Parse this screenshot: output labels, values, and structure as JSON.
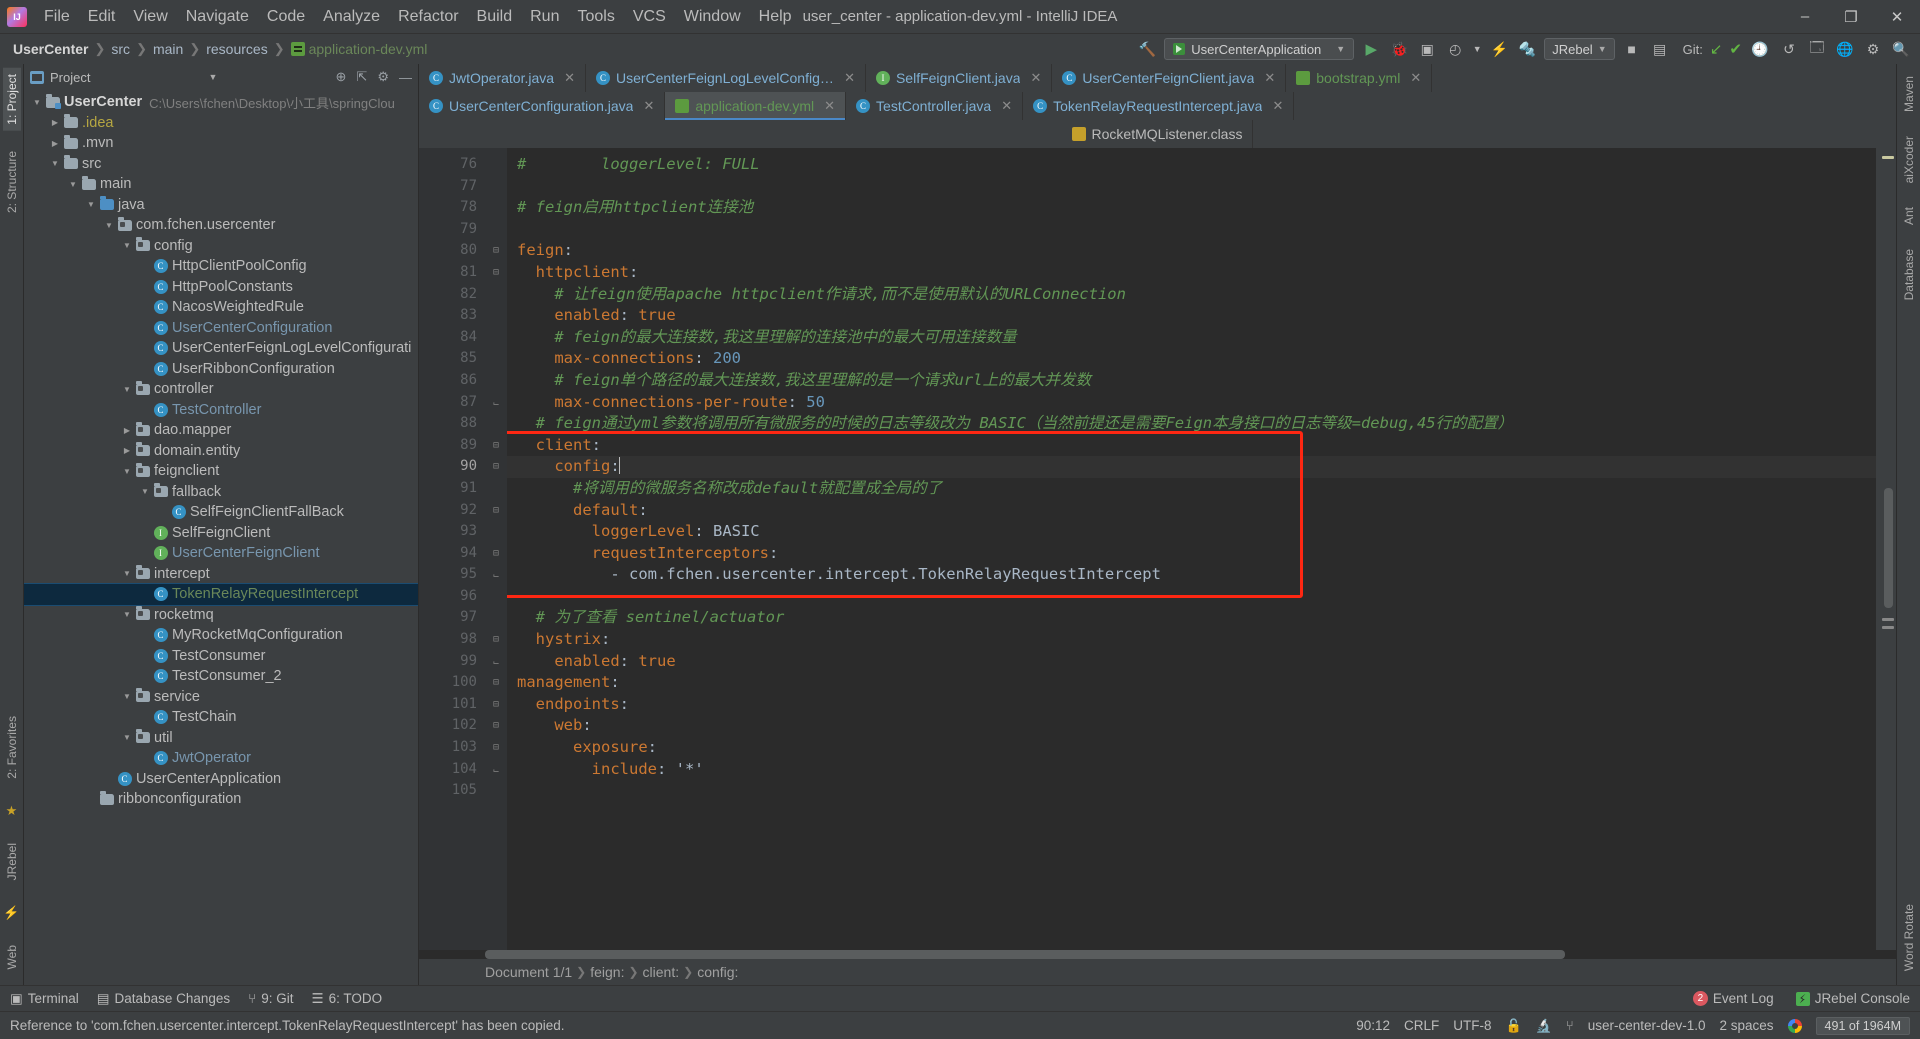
{
  "window": {
    "title": "user_center - application-dev.yml - IntelliJ IDEA",
    "minimize": "–",
    "maximize": "❐",
    "close": "✕"
  },
  "menu": [
    "File",
    "Edit",
    "View",
    "Navigate",
    "Code",
    "Analyze",
    "Refactor",
    "Build",
    "Run",
    "Tools",
    "VCS",
    "Window",
    "Help"
  ],
  "navbar": {
    "crumbs": [
      "UserCenter",
      "src",
      "main",
      "resources",
      "application-dev.yml"
    ],
    "run_config": "UserCenterApplication",
    "jrebel_label": "JRebel",
    "git_label": "Git:",
    "hammer_icon": "build-icon",
    "run_icon": "run-icon",
    "debug_icon": "debug-icon",
    "coverage_icon": "coverage-icon",
    "profiler_icon": "profiler-icon",
    "stop_icon": "stop-icon",
    "update_icon": "update-project-icon",
    "commit_icon": "commit-icon",
    "rollback_icon": "rollback-icon",
    "search_icon": "search-everywhere-icon",
    "settings_icon": "settings-icon"
  },
  "left_rail": {
    "tabs": [
      "1: Project",
      "2: Structure",
      "2: Favorites",
      "JRebel",
      "Web"
    ],
    "star_icon": "favorites-star-icon"
  },
  "right_rail": {
    "tabs": [
      "Maven",
      "aiXcoder",
      "Ant",
      "Database",
      "Word Rotate"
    ]
  },
  "project_panel": {
    "title": "Project",
    "expand_icon": "locate-icon",
    "collapse_icon": "collapse-all-icon",
    "settings_icon": "gear-icon",
    "hide_icon": "hide-icon",
    "tree": [
      {
        "depth": 0,
        "arrow": "down",
        "icon": "module",
        "label": "UserCenter",
        "style": "bold",
        "sub": "C:\\Users\\fchen\\Desktop\\小工具\\springClou"
      },
      {
        "depth": 1,
        "arrow": "right",
        "icon": "folder",
        "label": ".idea",
        "style": "yellow"
      },
      {
        "depth": 1,
        "arrow": "right",
        "icon": "folder",
        "label": ".mvn",
        "style": ""
      },
      {
        "depth": 1,
        "arrow": "down",
        "icon": "folder",
        "label": "src",
        "style": ""
      },
      {
        "depth": 2,
        "arrow": "down",
        "icon": "folder",
        "label": "main",
        "style": ""
      },
      {
        "depth": 3,
        "arrow": "down",
        "icon": "folderblue",
        "label": "java",
        "style": ""
      },
      {
        "depth": 4,
        "arrow": "down",
        "icon": "pkg",
        "label": "com.fchen.usercenter",
        "style": ""
      },
      {
        "depth": 5,
        "arrow": "down",
        "icon": "pkg",
        "label": "config",
        "style": ""
      },
      {
        "depth": 6,
        "arrow": "none",
        "icon": "class",
        "label": "HttpClientPoolConfig",
        "style": ""
      },
      {
        "depth": 6,
        "arrow": "none",
        "icon": "class",
        "label": "HttpPoolConstants",
        "style": ""
      },
      {
        "depth": 6,
        "arrow": "none",
        "icon": "class",
        "label": "NacosWeightedRule",
        "style": ""
      },
      {
        "depth": 6,
        "arrow": "none",
        "icon": "class",
        "label": "UserCenterConfiguration",
        "style": "blue"
      },
      {
        "depth": 6,
        "arrow": "none",
        "icon": "class",
        "label": "UserCenterFeignLogLevelConfigurati",
        "style": ""
      },
      {
        "depth": 6,
        "arrow": "none",
        "icon": "class",
        "label": "UserRibbonConfiguration",
        "style": ""
      },
      {
        "depth": 5,
        "arrow": "down",
        "icon": "pkg",
        "label": "controller",
        "style": ""
      },
      {
        "depth": 6,
        "arrow": "none",
        "icon": "class",
        "label": "TestController",
        "style": "blue"
      },
      {
        "depth": 5,
        "arrow": "right",
        "icon": "pkg",
        "label": "dao.mapper",
        "style": ""
      },
      {
        "depth": 5,
        "arrow": "right",
        "icon": "pkg",
        "label": "domain.entity",
        "style": ""
      },
      {
        "depth": 5,
        "arrow": "down",
        "icon": "pkg",
        "label": "feignclient",
        "style": ""
      },
      {
        "depth": 6,
        "arrow": "down",
        "icon": "pkg",
        "label": "fallback",
        "style": ""
      },
      {
        "depth": 7,
        "arrow": "none",
        "icon": "class",
        "label": "SelfFeignClientFallBack",
        "style": ""
      },
      {
        "depth": 6,
        "arrow": "none",
        "icon": "iface",
        "label": "SelfFeignClient",
        "style": ""
      },
      {
        "depth": 6,
        "arrow": "none",
        "icon": "iface",
        "label": "UserCenterFeignClient",
        "style": "blue"
      },
      {
        "depth": 5,
        "arrow": "down",
        "icon": "pkg",
        "label": "intercept",
        "style": ""
      },
      {
        "depth": 6,
        "arrow": "none",
        "icon": "class",
        "label": "TokenRelayRequestIntercept",
        "style": "green",
        "selected": true
      },
      {
        "depth": 5,
        "arrow": "down",
        "icon": "pkg",
        "label": "rocketmq",
        "style": ""
      },
      {
        "depth": 6,
        "arrow": "none",
        "icon": "class",
        "label": "MyRocketMqConfiguration",
        "style": ""
      },
      {
        "depth": 6,
        "arrow": "none",
        "icon": "class",
        "label": "TestConsumer",
        "style": ""
      },
      {
        "depth": 6,
        "arrow": "none",
        "icon": "class",
        "label": "TestConsumer_2",
        "style": ""
      },
      {
        "depth": 5,
        "arrow": "down",
        "icon": "pkg",
        "label": "service",
        "style": ""
      },
      {
        "depth": 6,
        "arrow": "none",
        "icon": "class",
        "label": "TestChain",
        "style": ""
      },
      {
        "depth": 5,
        "arrow": "down",
        "icon": "pkg",
        "label": "util",
        "style": ""
      },
      {
        "depth": 6,
        "arrow": "none",
        "icon": "class",
        "label": "JwtOperator",
        "style": "blue"
      },
      {
        "depth": 4,
        "arrow": "none",
        "icon": "class",
        "label": "UserCenterApplication",
        "style": ""
      },
      {
        "depth": 3,
        "arrow": "none",
        "icon": "folder",
        "label": "ribbonconfiguration",
        "style": ""
      }
    ]
  },
  "editor_tabs_row1": [
    {
      "label": "JwtOperator.java",
      "icon": "class",
      "color": "blue",
      "active": false
    },
    {
      "label": "UserCenterFeignLogLevelConfiguration.java",
      "icon": "class",
      "color": "blue",
      "active": false
    },
    {
      "label": "SelfFeignClient.java",
      "icon": "iface",
      "color": "blue",
      "active": false
    },
    {
      "label": "UserCenterFeignClient.java",
      "icon": "class",
      "color": "blue",
      "active": false
    },
    {
      "label": "bootstrap.yml",
      "icon": "yml",
      "color": "green",
      "active": false
    }
  ],
  "editor_tabs_row2": [
    {
      "label": "UserCenterConfiguration.java",
      "icon": "class",
      "color": "blue",
      "active": false
    },
    {
      "label": "application-dev.yml",
      "icon": "yml",
      "color": "green",
      "active": true
    },
    {
      "label": "TestController.java",
      "icon": "class",
      "color": "blue",
      "active": false
    },
    {
      "label": "TokenRelayRequestIntercept.java",
      "icon": "class",
      "color": "blue",
      "active": false
    }
  ],
  "editor_tabs_row3": [
    {
      "label": "RocketMQListener.class",
      "icon": "mq",
      "color": "plain",
      "active": false
    }
  ],
  "code": {
    "first_line": 76,
    "current_line": 90,
    "lines": [
      {
        "n": 76,
        "fold": "",
        "segs": [
          {
            "t": "#        loggerLevel: FULL",
            "c": "cmt"
          }
        ]
      },
      {
        "n": 77,
        "fold": "",
        "segs": []
      },
      {
        "n": 78,
        "fold": "",
        "segs": [
          {
            "t": "# feign启用httpclient连接池",
            "c": "cmt"
          }
        ]
      },
      {
        "n": 79,
        "fold": "",
        "segs": []
      },
      {
        "n": 80,
        "fold": "minus",
        "segs": [
          {
            "t": "feign",
            "c": "key"
          },
          {
            "t": ":",
            "c": "plain"
          }
        ]
      },
      {
        "n": 81,
        "fold": "minus",
        "segs": [
          {
            "t": "  httpclient",
            "c": "key"
          },
          {
            "t": ":",
            "c": "plain"
          }
        ]
      },
      {
        "n": 82,
        "fold": "",
        "segs": [
          {
            "t": "    # 让feign使用apache httpclient作请求,而不是使用默认的URLConnection",
            "c": "cmt"
          }
        ]
      },
      {
        "n": 83,
        "fold": "",
        "segs": [
          {
            "t": "    enabled",
            "c": "key"
          },
          {
            "t": ": ",
            "c": "plain"
          },
          {
            "t": "true",
            "c": "k"
          }
        ]
      },
      {
        "n": 84,
        "fold": "",
        "segs": [
          {
            "t": "    # feign的最大连接数,我这里理解的连接池中的最大可用连接数量",
            "c": "cmt"
          }
        ]
      },
      {
        "n": 85,
        "fold": "",
        "segs": [
          {
            "t": "    max-connections",
            "c": "key"
          },
          {
            "t": ": ",
            "c": "plain"
          },
          {
            "t": "200",
            "c": "num"
          }
        ]
      },
      {
        "n": 86,
        "fold": "",
        "segs": [
          {
            "t": "    # feign单个路径的最大连接数,我这里理解的是一个请求url上的最大并发数",
            "c": "cmt"
          }
        ]
      },
      {
        "n": 87,
        "fold": "end",
        "segs": [
          {
            "t": "    max-connections-per-route",
            "c": "key"
          },
          {
            "t": ": ",
            "c": "plain"
          },
          {
            "t": "50",
            "c": "num"
          }
        ]
      },
      {
        "n": 88,
        "fold": "",
        "segs": [
          {
            "t": "  # feign通过yml参数将调用所有微服务的时候的日志等级改为 BASIC（当然前提还是需要Feign本身接口的日志等级=debug,45行的配置）",
            "c": "cmt"
          }
        ]
      },
      {
        "n": 89,
        "fold": "minus",
        "segs": [
          {
            "t": "  client",
            "c": "key"
          },
          {
            "t": ":",
            "c": "plain"
          }
        ]
      },
      {
        "n": 90,
        "fold": "minus",
        "current": true,
        "segs": [
          {
            "t": "    config",
            "c": "key"
          },
          {
            "t": ":",
            "c": "plain"
          }
        ],
        "caret": true
      },
      {
        "n": 91,
        "fold": "",
        "segs": [
          {
            "t": "      #将调用的微服务名称改成default就配置成全局的了",
            "c": "cmt"
          }
        ]
      },
      {
        "n": 92,
        "fold": "minus",
        "segs": [
          {
            "t": "      default",
            "c": "key"
          },
          {
            "t": ":",
            "c": "plain"
          }
        ]
      },
      {
        "n": 93,
        "fold": "",
        "segs": [
          {
            "t": "        loggerLevel",
            "c": "key"
          },
          {
            "t": ": ",
            "c": "plain"
          },
          {
            "t": "BASIC",
            "c": "val"
          }
        ]
      },
      {
        "n": 94,
        "fold": "minus",
        "segs": [
          {
            "t": "        requestInterceptors",
            "c": "key"
          },
          {
            "t": ":",
            "c": "plain"
          }
        ]
      },
      {
        "n": 95,
        "fold": "end",
        "segs": [
          {
            "t": "          - ",
            "c": "plain"
          },
          {
            "t": "com.fchen.usercenter.intercept.TokenRelayRequestIntercept",
            "c": "val"
          }
        ]
      },
      {
        "n": 96,
        "fold": "",
        "segs": []
      },
      {
        "n": 97,
        "fold": "",
        "segs": [
          {
            "t": "  # 为了查看 sentinel/actuator",
            "c": "cmt"
          }
        ]
      },
      {
        "n": 98,
        "fold": "minus",
        "segs": [
          {
            "t": "  hystrix",
            "c": "key"
          },
          {
            "t": ":",
            "c": "plain"
          }
        ]
      },
      {
        "n": 99,
        "fold": "end",
        "segs": [
          {
            "t": "    enabled",
            "c": "key"
          },
          {
            "t": ": ",
            "c": "plain"
          },
          {
            "t": "true",
            "c": "k"
          }
        ]
      },
      {
        "n": 100,
        "fold": "minus",
        "segs": [
          {
            "t": "management",
            "c": "key"
          },
          {
            "t": ":",
            "c": "plain"
          }
        ]
      },
      {
        "n": 101,
        "fold": "minus",
        "segs": [
          {
            "t": "  endpoints",
            "c": "key"
          },
          {
            "t": ":",
            "c": "plain"
          }
        ]
      },
      {
        "n": 102,
        "fold": "minus",
        "segs": [
          {
            "t": "    web",
            "c": "key"
          },
          {
            "t": ":",
            "c": "plain"
          }
        ]
      },
      {
        "n": 103,
        "fold": "minus",
        "segs": [
          {
            "t": "      exposure",
            "c": "key"
          },
          {
            "t": ":",
            "c": "plain"
          }
        ]
      },
      {
        "n": 104,
        "fold": "end",
        "segs": [
          {
            "t": "        include",
            "c": "key"
          },
          {
            "t": ": ",
            "c": "plain"
          },
          {
            "t": "'*'",
            "c": "val"
          }
        ]
      },
      {
        "n": 105,
        "fold": "",
        "segs": []
      }
    ]
  },
  "editor_breadcrumb": [
    "Document 1/1",
    "feign:",
    "client:",
    "config:"
  ],
  "bottom_toolbar": {
    "left": [
      {
        "label": "Terminal",
        "icon": "terminal-icon"
      },
      {
        "label": "Database Changes",
        "icon": "database-icon"
      },
      {
        "label": "9: Git",
        "icon": "git-icon"
      },
      {
        "label": "6: TODO",
        "icon": "todo-icon"
      }
    ],
    "right": [
      {
        "label": "Event Log",
        "icon": "event-log-icon",
        "badge": "2"
      },
      {
        "label": "JRebel Console",
        "icon": "jrebel-icon"
      }
    ]
  },
  "statusbar": {
    "message": "Reference to 'com.fchen.usercenter.intercept.TokenRelayRequestIntercept' has been copied.",
    "caret": "90:12",
    "line_sep": "CRLF",
    "encoding": "UTF-8",
    "lock_icon": "read-only-lock-icon",
    "inspector_icon": "inspection-icon",
    "branch_icon": "git-branch-icon",
    "branch": "user-center-dev-1.0",
    "indent": "2 spaces",
    "google_icon": "google-icon",
    "memory": "491 of 1964M"
  },
  "colors": {
    "accent": "#4a88c7",
    "highlight_box": "#fe2712",
    "selection": "#0d293e",
    "comment": "#629755",
    "key": "#cc7832",
    "number": "#6897bb",
    "string": "#a9b7c6"
  }
}
